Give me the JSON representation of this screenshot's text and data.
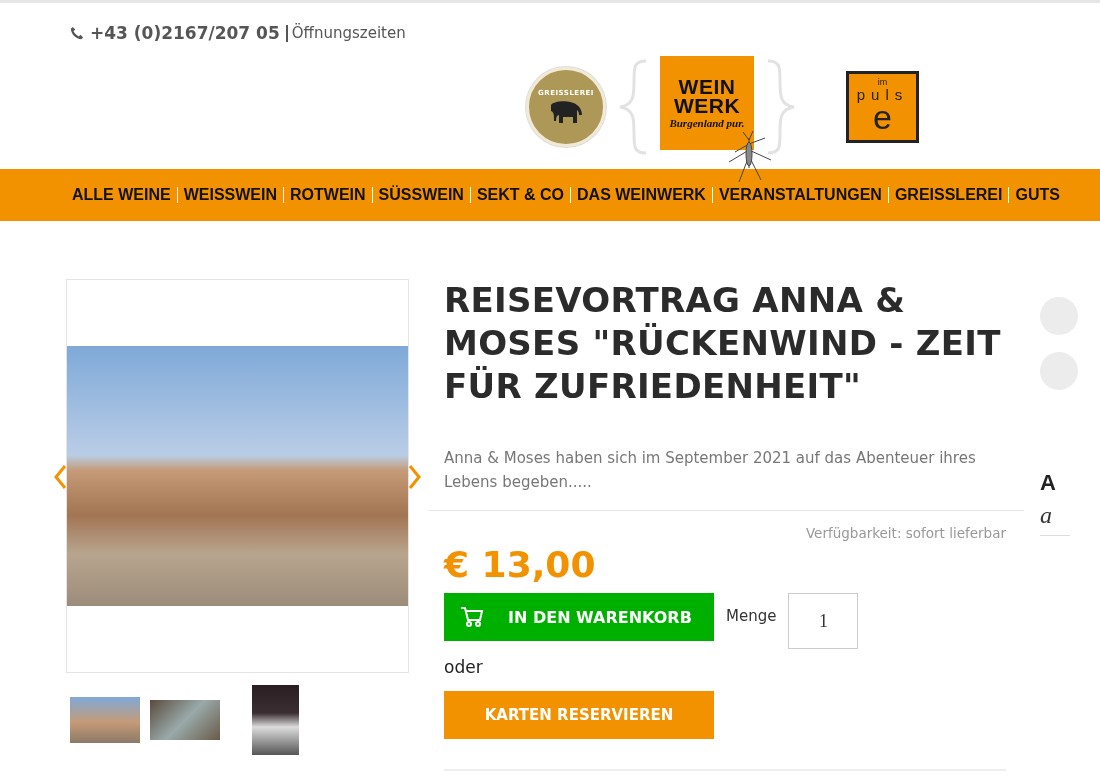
{
  "header": {
    "phone": "+43 (0)2167/207 05",
    "opening_hours_link": "Öffnungszeiten"
  },
  "logos": {
    "greisslerei": "GREISSLEREI",
    "weinwerk_lines": [
      "WEIN",
      "WERK"
    ],
    "weinwerk_tagline": "Burgenland pur.",
    "impulse_top": "im",
    "impulse_middle": "puls",
    "impulse_bottom": "e"
  },
  "nav": [
    "ALLE WEINE",
    "WEISSWEIN",
    "ROTWEIN",
    "SÜSSWEIN",
    "SEKT & CO",
    "DAS WEINWERK",
    "VERANSTALTUNGEN",
    "GREISSLEREI",
    "GUTS"
  ],
  "product": {
    "title": "REISEVORTRAG ANNA & MOSES \"RÜCKENWIND - ZEIT FÜR ZUFRIEDENHEIT\"",
    "description": "Anna & Moses haben sich im September 2021 auf das Abenteuer ihres Lebens begeben.....",
    "availability": "Verfügbarkeit: sofort lieferbar",
    "price": "€ 13,00",
    "cart_button": "IN DEN WARENKORB",
    "quantity_label": "Menge",
    "quantity": "1",
    "or_text": "oder",
    "reserve_button": "KARTEN RESERVIEREN"
  },
  "side_column": {
    "heading": "A",
    "subtext": "a"
  }
}
